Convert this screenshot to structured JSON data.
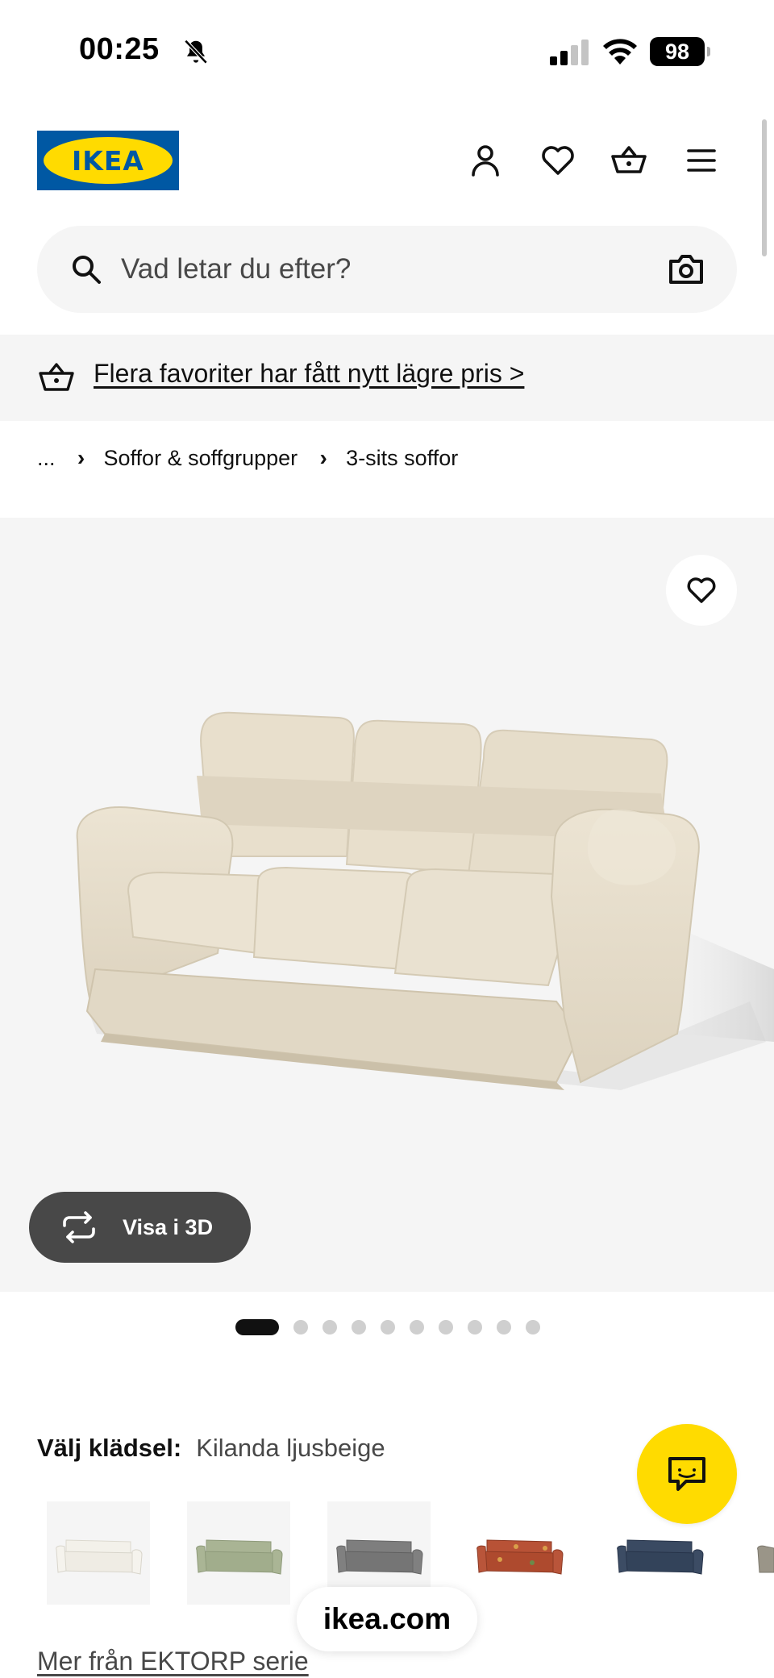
{
  "status_bar": {
    "time": "00:25",
    "battery": "98",
    "icons": [
      "bell-slash-icon",
      "cellular-signal-icon",
      "wifi-icon",
      "battery-icon"
    ]
  },
  "header": {
    "logo_text": "IKEA",
    "icons": [
      "user-icon",
      "heart-icon",
      "shopping-bag-icon",
      "menu-icon"
    ],
    "colors": {
      "logo_blue": "#0058a3",
      "logo_yellow": "#ffdb00"
    }
  },
  "search": {
    "placeholder": "Vad letar du efter?",
    "value": ""
  },
  "promo": {
    "text": "Flera favoriter har fått nytt lägre pris >"
  },
  "breadcrumb": {
    "items": [
      "...",
      "Soffor & soffgrupper",
      "3-sits soffor"
    ],
    "separator": "›"
  },
  "product_gallery": {
    "view_3d_label": "Visa i 3D",
    "image_count": 10,
    "active_index": 0,
    "main_image": "beige-three-seat-sofa"
  },
  "variant": {
    "label": "Välj klädsel:",
    "selected": "Kilanda ljusbeige",
    "swatches": [
      {
        "name": "white-sofa",
        "color": "#eceae3"
      },
      {
        "name": "green-sofa",
        "color": "#a5b08f"
      },
      {
        "name": "grey-sofa",
        "color": "#7a7a7a"
      },
      {
        "name": "floral-red-sofa",
        "color": "#b34a2e"
      },
      {
        "name": "dark-blue-sofa",
        "color": "#34445a"
      },
      {
        "name": "striped-sofa",
        "color": "#9a9588"
      }
    ]
  },
  "more_link": "Mer från EKTORP serie",
  "chat": {
    "color": "#ffdb00"
  },
  "browser": {
    "url": "ikea.com"
  }
}
